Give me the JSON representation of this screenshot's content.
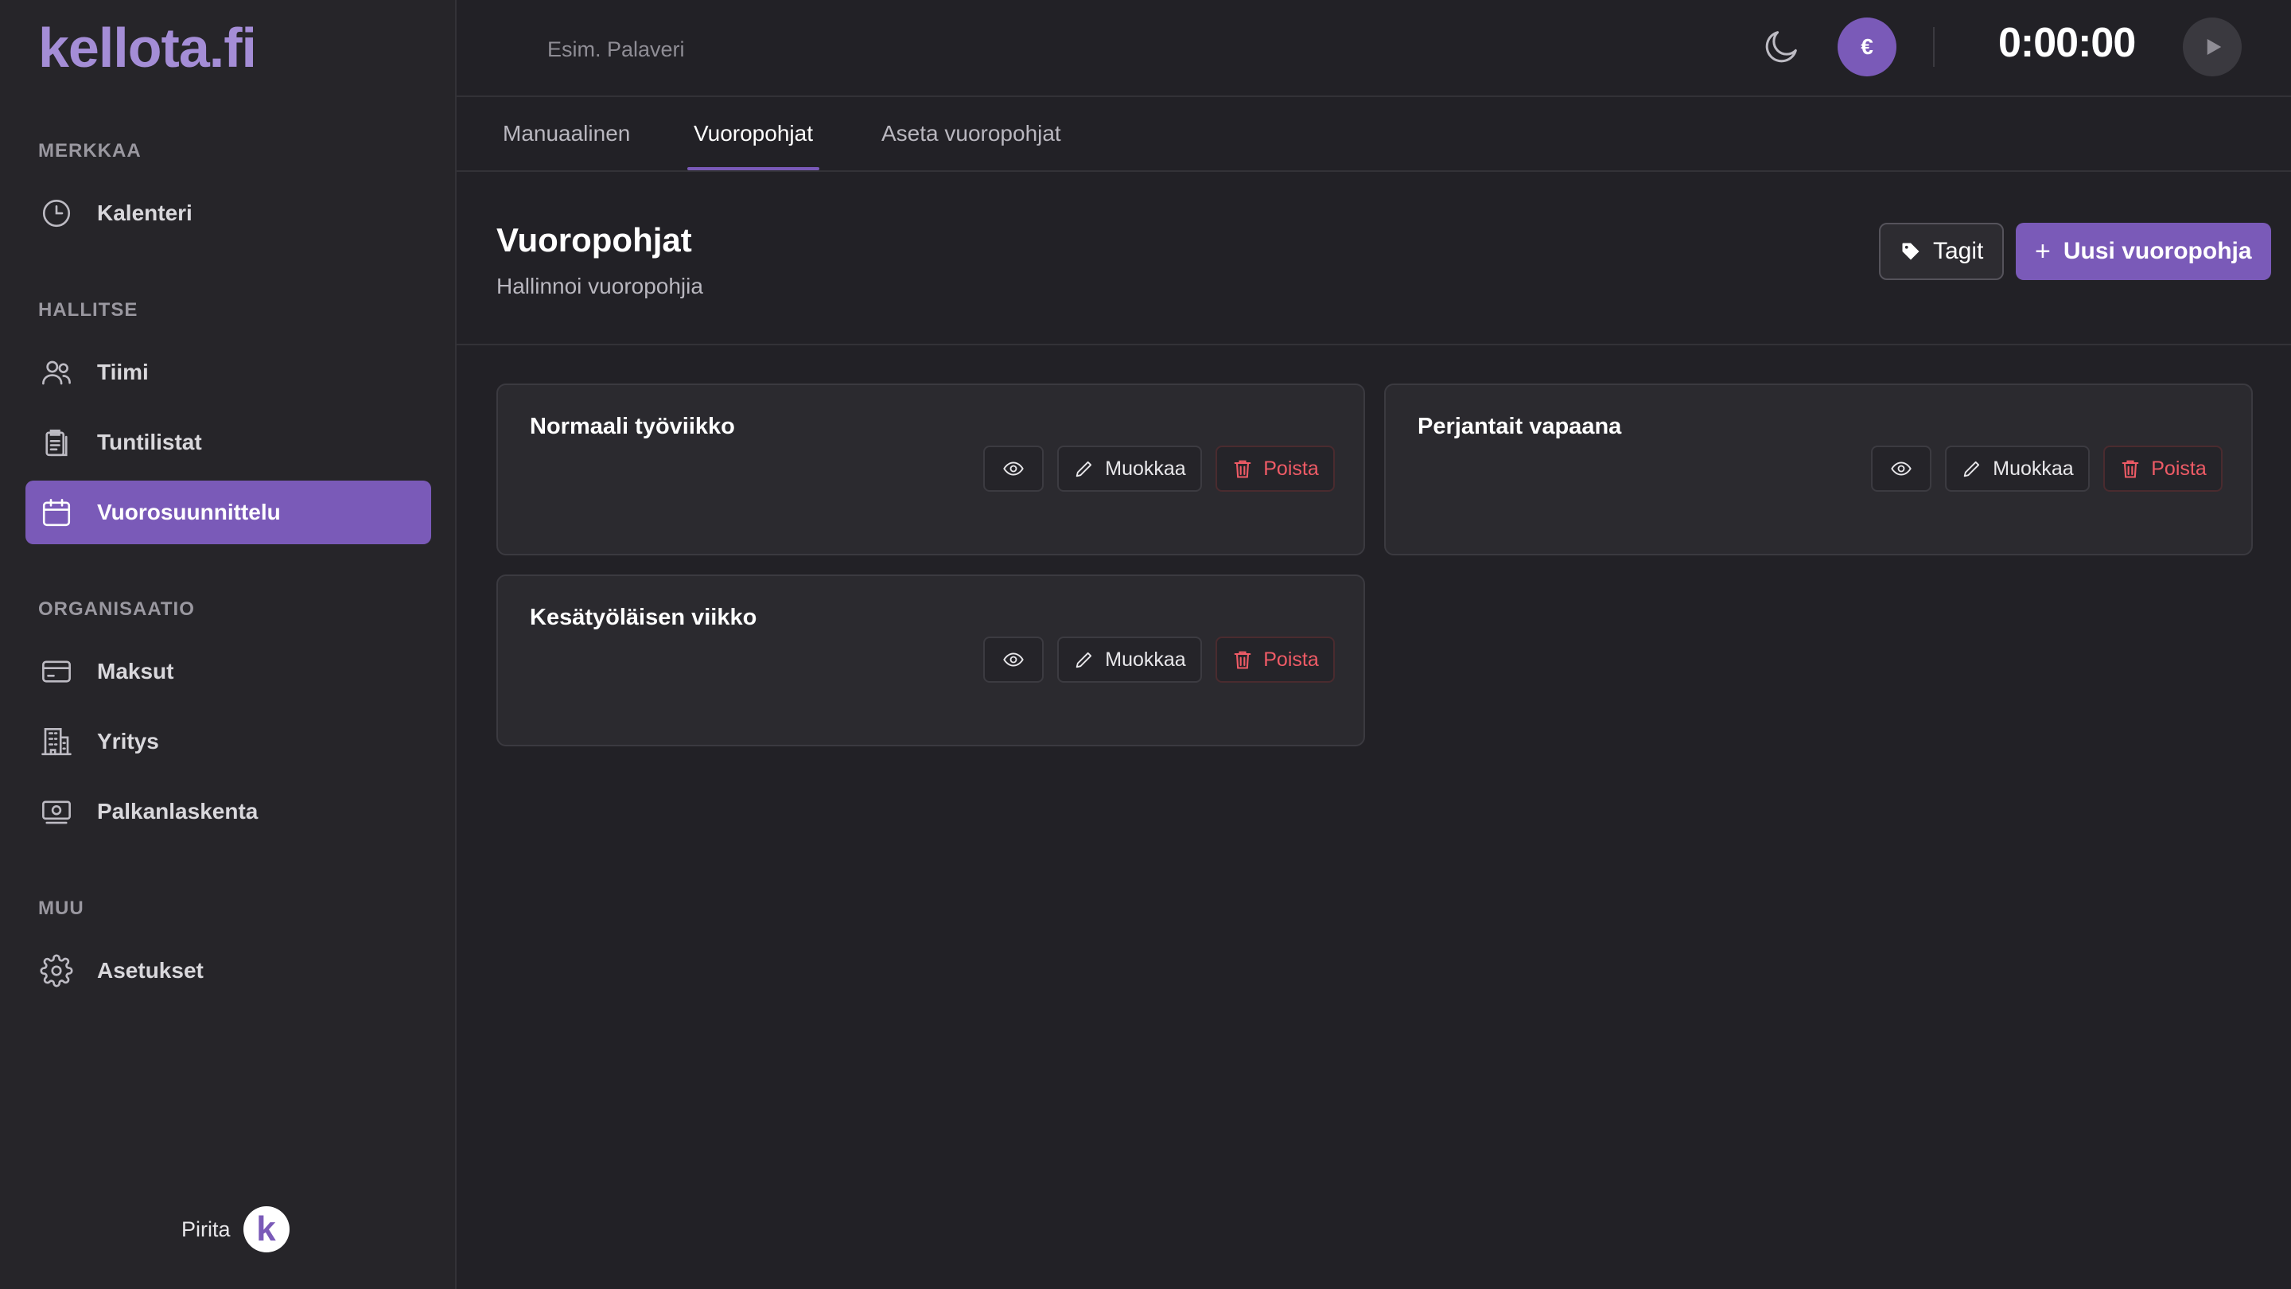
{
  "app": {
    "logo": "kellota.fi"
  },
  "sidebar": {
    "sections": [
      {
        "label": "MERKKAA"
      },
      {
        "label": "HALLITSE"
      },
      {
        "label": "ORGANISAATIO"
      },
      {
        "label": "MUU"
      }
    ],
    "items": [
      {
        "label": "Kalenteri",
        "icon": "clock-icon"
      },
      {
        "label": "Tiimi",
        "icon": "users-icon"
      },
      {
        "label": "Tuntilistat",
        "icon": "clipboard-icon"
      },
      {
        "label": "Vuorosuunnittelu",
        "icon": "calendar-icon",
        "active": true
      },
      {
        "label": "Maksut",
        "icon": "credit-card-icon"
      },
      {
        "label": "Yritys",
        "icon": "building-icon"
      },
      {
        "label": "Palkanlaskenta",
        "icon": "money-icon"
      },
      {
        "label": "Asetukset",
        "icon": "gear-icon"
      }
    ],
    "footer": {
      "user": "Pirita",
      "logo_letter": "k"
    }
  },
  "header": {
    "search_placeholder": "Esim. Palaveri",
    "currency_symbol": "€",
    "timer": "0:00:00"
  },
  "tabs": [
    {
      "label": "Manuaalinen"
    },
    {
      "label": "Vuoropohjat",
      "active": true
    },
    {
      "label": "Aseta vuoropohjat"
    }
  ],
  "page": {
    "title": "Vuoropohjat",
    "subtitle": "Hallinnoi vuoropohjia",
    "tags_label": "Tagit",
    "new_label": "Uusi vuoropohja"
  },
  "templates": [
    {
      "name": "Normaali työviikko",
      "edit_label": "Muokkaa",
      "delete_label": "Poista"
    },
    {
      "name": "Perjantait vapaana",
      "edit_label": "Muokkaa",
      "delete_label": "Poista"
    },
    {
      "name": "Kesätyöläisen viikko",
      "edit_label": "Muokkaa",
      "delete_label": "Poista"
    }
  ],
  "colors": {
    "accent": "#7a5ab8",
    "background": "#222126",
    "sidebar": "#262529",
    "danger": "#ef5b66"
  }
}
